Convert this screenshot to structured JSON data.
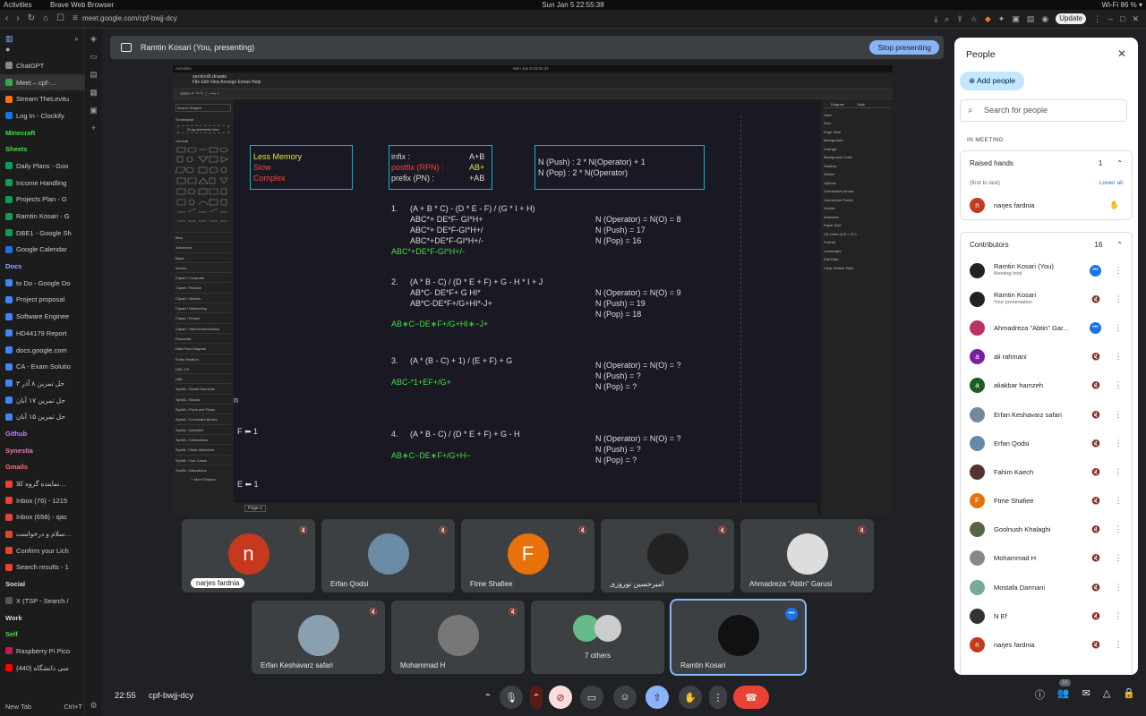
{
  "os": {
    "left": "Activities",
    "app": "Brave Web Browser",
    "clock": "Sun Jan 5  22:55:38",
    "status": "Wi-Fi 86 % ▾"
  },
  "browser": {
    "url": "meet.google.com/cpf-bwjj-dcy",
    "update": "Update"
  },
  "sidebar": {
    "items": [
      {
        "label": "ChatGPT",
        "color": "#888"
      },
      {
        "label": "Meet – cpf-…",
        "color": "#34a853",
        "active": true
      },
      {
        "label": "Stream TheLevitu",
        "color": "#f97316"
      },
      {
        "label": "Log In - Clockify",
        "color": "#1a73e8"
      },
      {
        "label": "Minecraft",
        "color": "",
        "header": true,
        "hcolor": "#40e040"
      },
      {
        "label": "Sheets",
        "color": "",
        "header": true,
        "hcolor": "#40e040"
      },
      {
        "label": "Daily Plans - Goo",
        "color": "#0f9d58"
      },
      {
        "label": "Income Handling",
        "color": "#0f9d58"
      },
      {
        "label": "Projects Plan - G",
        "color": "#0f9d58"
      },
      {
        "label": "Ramtin Kosari - G",
        "color": "#0f9d58"
      },
      {
        "label": "DBE1 - Google Sh",
        "color": "#0f9d58"
      },
      {
        "label": "Google Calendar",
        "color": "#1a73e8"
      },
      {
        "label": "Docs",
        "color": "",
        "header": true,
        "hcolor": "#8ab4f8"
      },
      {
        "label": "to Do - Google Do",
        "color": "#4285f4"
      },
      {
        "label": "Project proposal",
        "color": "#4285f4"
      },
      {
        "label": "Software Enginee",
        "color": "#4285f4"
      },
      {
        "label": "HD44179 Report",
        "color": "#4285f4"
      },
      {
        "label": "docs.google.com",
        "color": "#4285f4"
      },
      {
        "label": "CA - Exam Solutio",
        "color": "#4285f4"
      },
      {
        "label": "حل تمرین ۸ آذر ۳",
        "color": "#4285f4"
      },
      {
        "label": "حل تمرین ۱۷ آبان",
        "color": "#4285f4"
      },
      {
        "label": "حل تمرین ۱۵ آبان",
        "color": "#4285f4"
      },
      {
        "label": "Github",
        "color": "",
        "header": true,
        "hcolor": "#c084fc"
      },
      {
        "label": "Synestia",
        "color": "",
        "header": true,
        "hcolor": "#f472b6"
      },
      {
        "label": "Gmails",
        "color": "",
        "header": true,
        "hcolor": "#f87171"
      },
      {
        "label": "نماینده گروه کلا…",
        "color": "#ea4335"
      },
      {
        "label": "Inbox (76) - 1215",
        "color": "#ea4335"
      },
      {
        "label": "Inbox (658) - qas",
        "color": "#ea4335"
      },
      {
        "label": "سلام و درخواست…",
        "color": "#ea4335"
      },
      {
        "label": "Confirm your Lich",
        "color": "#ea4335"
      },
      {
        "label": "Search results - 1",
        "color": "#ea4335"
      },
      {
        "label": "Social",
        "color": "",
        "header": true,
        "hcolor": "#ddd"
      },
      {
        "label": "X (TSP - Search / ",
        "color": "#555"
      },
      {
        "label": "Work",
        "color": "",
        "header": true,
        "hcolor": "#ddd"
      },
      {
        "label": "Self",
        "color": "",
        "header": true,
        "hcolor": "#40e040"
      },
      {
        "label": "Raspberry Pi Pico",
        "color": "#c2185b"
      },
      {
        "label": "(440) سی دانشگاه",
        "color": "#ff0000"
      }
    ],
    "new_tab": "New Tab",
    "new_tab_hint": "Ctrl+T"
  },
  "banner": {
    "text": "Ramtin Kosari (You, presenting)",
    "stop": "Stop presenting"
  },
  "shared": {
    "top_left": "Activities",
    "top_center": "Mon Jan 6 03:02:34",
    "subtitle": "section8.drawio - drawio",
    "file": "section8.drawio",
    "menu": "File   Edit   View   Arrange   Extras   Help",
    "toolbar": "100%   ↶ ↷   ✎   ⬚   ⟶   +",
    "search_shapes": "Search Shapes",
    "scratchpad": "Scratchpad",
    "drag_hint": "Drag elements here",
    "general": "General",
    "libraries": [
      "Misc",
      "Advanced",
      "Basic",
      "Arrows",
      "Clipart / Computer",
      "Clipart / Finance",
      "Clipart / Various",
      "Clipart / Networking",
      "Clipart / People",
      "Clipart / Telecommunication",
      "Flowchart",
      "Data Flow Diagram",
      "Entity Relation",
      "UML 2.5",
      "UML",
      "SysML / Model Elements",
      "SysML / Blocks",
      "SysML / Ports and Flows",
      "SysML / Constraint Blocks",
      "SysML / Activities",
      "SysML / Interactions",
      "SysML / State Machines",
      "SysML / Use Cases",
      "SysML / Allocations"
    ],
    "more_shapes": "+ More Shapes",
    "right_tabs": [
      "Diagram",
      "Style"
    ],
    "right_items": [
      "View",
      "Grid",
      "Page View",
      "Background",
      "Change...",
      "Background Color",
      "Shadow",
      "Sketch",
      "Options",
      "Connection Arrows",
      "Connection Points",
      "Guides",
      "Autosave",
      "Paper Size",
      "US-Letter (8.5 × 11\")",
      "Portrait",
      "Landscape",
      "Edit Data",
      "Clear Default Style"
    ],
    "page_tab": "Page-1",
    "box1": [
      "Less Memory",
      "Slow",
      "Complex"
    ],
    "box2": {
      "rows": [
        [
          "infix :",
          "A+B"
        ],
        [
          "postfix (RPN) :",
          "AB+"
        ],
        [
          "prefix (PN) :",
          "+AB"
        ]
      ]
    },
    "box3": [
      "N (Push) :        2 * N(Operator) + 1",
      "N (Pop) :          2 * N(Operator)"
    ],
    "q1": {
      "num": "1.",
      "expr": "(A + B * C) - (D * E - F) / (G * I + H)",
      "steps": [
        "ABC*+                 DE*F-             GI*H+",
        "ABC*+                 DE*F-GI*H+/",
        "ABC*+DE*F-GI*H+/-"
      ],
      "answer": "ABC*+DE*F-GI*H+/-",
      "stats": [
        "N (Operator) = N(O) = 8",
        "N (Push) = 17",
        "N (Pop) = 16"
      ]
    },
    "q2": {
      "num": "2.",
      "expr": "(A * B - C) / (D * E + F) + G - H * I + J",
      "steps": [
        "AB*C-                 DE*F+      G      HI*",
        "AB*C-DE*F+/G+HI*-J+"
      ],
      "answer": "AB∗C−DE∗F+/G+HI∗−J+",
      "stats": [
        "N (Operator) = N(O) = 9",
        "N (Push) = 19",
        "N (Pop) = 18"
      ]
    },
    "q3": {
      "num": "3.",
      "expr": "(A * (B - C) + 1) / (E + F) + G",
      "answer": "ABC-*1+EF+/G+",
      "stats": [
        "N (Operator) = N(O) = ?",
        "N (Push) = ?",
        "N (Pop) = ?"
      ]
    },
    "q4": {
      "num": "4.",
      "expr": "(A * B - C) / (D * E + F) + G - H",
      "answer": "AB∗C−DE∗F+/G+H−",
      "stats": [
        "N (Operator) = N(O) = ?",
        "N (Push) = ?",
        "N (Pop) = ?"
      ]
    },
    "edge_1": "F ⬅ 1",
    "edge_2": "E ⬅ 1",
    "edge_n": "n"
  },
  "tiles": [
    {
      "name": "narjes fardnia",
      "initial": "n",
      "color": "#c5391f",
      "hand": true
    },
    {
      "name": "Erfan Qodsi",
      "initial": "",
      "color": "#6b8aa3"
    },
    {
      "name": "Ftme Shafiee",
      "initial": "F",
      "color": "#e8710a"
    },
    {
      "name": "امیرحسین نوروزی",
      "initial": "",
      "color": "#222"
    },
    {
      "name": "Ahmadreza “Abtin” Garusi",
      "initial": "",
      "color": "#ddd"
    },
    {
      "name": "Erfan Keshavarz safari",
      "initial": "",
      "color": "#8aa0b0"
    },
    {
      "name": "Mohammad H",
      "initial": "",
      "color": "#777"
    },
    {
      "name": "7 others",
      "initial": "",
      "color": ""
    },
    {
      "name": "Ramtin Kosari",
      "initial": "",
      "color": "#111",
      "selected": true
    }
  ],
  "bottom": {
    "clock": "22:55",
    "code": "cpf-bwjj-dcy",
    "badge": "16"
  },
  "panel": {
    "title": "People",
    "add": "Add people",
    "search": "Search for people",
    "in_meeting": "IN MEETING",
    "raised": {
      "title": "Raised hands",
      "count": "1",
      "order": "(first to last)",
      "lower": "Lower all",
      "person": "narjes fardnia"
    },
    "contrib": {
      "title": "Contributors",
      "count": "16"
    },
    "people": [
      {
        "name": "Ramtin Kosari (You)",
        "sub": "Meeting host",
        "initial": "",
        "color": "#222",
        "active": true
      },
      {
        "name": "Ramtin Kosari",
        "sub": "Your presentation",
        "initial": "",
        "color": "#222"
      },
      {
        "name": "Ahmadreza \"Abtin\" Gar...",
        "sub": "",
        "initial": "",
        "color": "#b36",
        "active": true
      },
      {
        "name": "ali rahmani",
        "sub": "",
        "initial": "a",
        "color": "#7b1fa2"
      },
      {
        "name": "aliakbar hamzeh",
        "sub": "",
        "initial": "a",
        "color": "#1b5e20"
      },
      {
        "name": "Erfan Keshavarz safari",
        "sub": "",
        "initial": "",
        "color": "#789"
      },
      {
        "name": "Erfan Qodsi",
        "sub": "",
        "initial": "",
        "color": "#68a"
      },
      {
        "name": "Fahim Kaech",
        "sub": "",
        "initial": "",
        "color": "#533"
      },
      {
        "name": "Ftme Shafiee",
        "sub": "",
        "initial": "F",
        "color": "#e8710a"
      },
      {
        "name": "Goolnush Khalaghi",
        "sub": "",
        "initial": "",
        "color": "#564"
      },
      {
        "name": "Mohammad H",
        "sub": "",
        "initial": "",
        "color": "#888"
      },
      {
        "name": "Mostafa Darmani",
        "sub": "",
        "initial": "",
        "color": "#7a9"
      },
      {
        "name": "N Ef",
        "sub": "",
        "initial": "",
        "color": "#333"
      },
      {
        "name": "narjes fardnia",
        "sub": "",
        "initial": "n",
        "color": "#c5391f"
      }
    ]
  }
}
